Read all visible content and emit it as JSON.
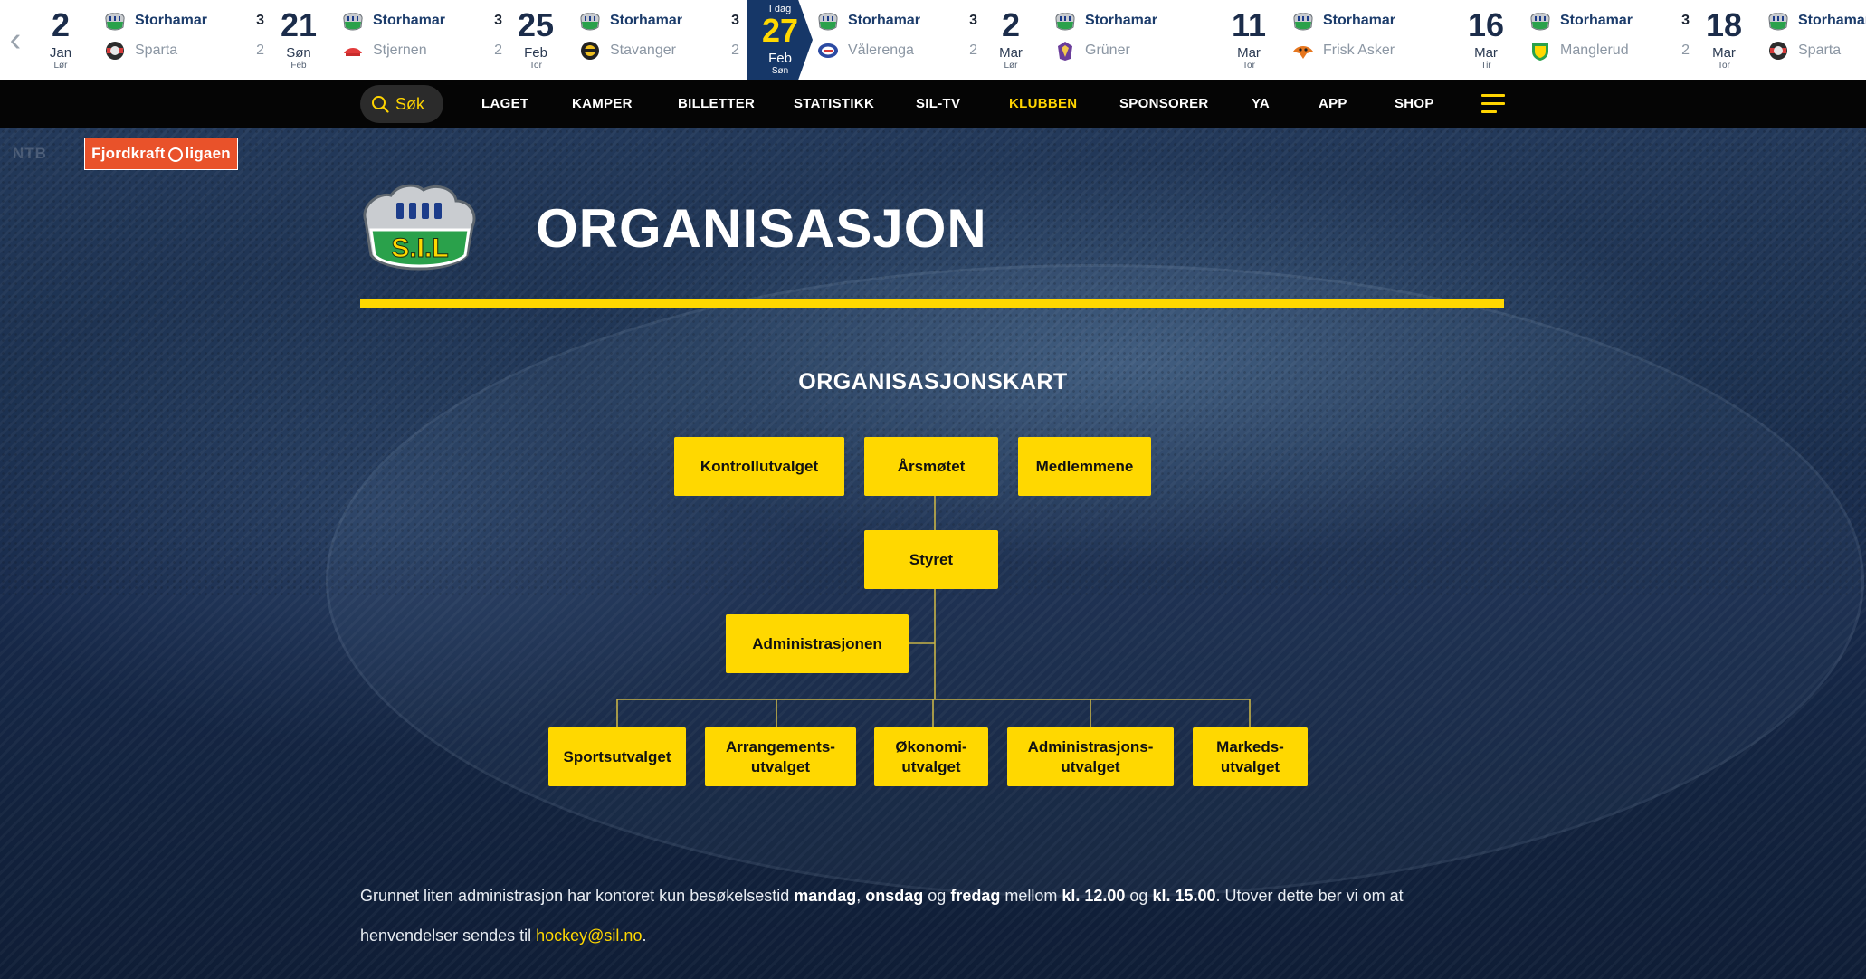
{
  "matches": [
    {
      "day": "2",
      "month": "Jan",
      "weekday": "Lør",
      "today_label": "",
      "home": "Storhamar",
      "home_score": "3",
      "away": "Sparta",
      "away_score": "2"
    },
    {
      "day": "21",
      "month": "Søn",
      "weekday": "Feb",
      "today_label": "",
      "home": "Storhamar",
      "home_score": "3",
      "away": "Stjernen",
      "away_score": "2"
    },
    {
      "day": "25",
      "month": "Feb",
      "weekday": "Tor",
      "today_label": "",
      "home": "Storhamar",
      "home_score": "3",
      "away": "Stavanger",
      "away_score": "2"
    },
    {
      "day": "27",
      "month": "Feb",
      "weekday": "Søn",
      "today_label": "I dag",
      "home": "Storhamar",
      "home_score": "3",
      "away": "Vålerenga",
      "away_score": "2"
    },
    {
      "day": "2",
      "month": "Mar",
      "weekday": "Lør",
      "today_label": "",
      "home": "Storhamar",
      "home_score": "",
      "away": "Grüner",
      "away_score": ""
    },
    {
      "day": "11",
      "month": "Mar",
      "weekday": "Tor",
      "today_label": "",
      "home": "Storhamar",
      "home_score": "",
      "away": "Frisk Asker",
      "away_score": ""
    },
    {
      "day": "16",
      "month": "Mar",
      "weekday": "Tir",
      "today_label": "",
      "home": "Storhamar",
      "home_score": "3",
      "away": "Manglerud",
      "away_score": "2"
    },
    {
      "day": "18",
      "month": "Mar",
      "weekday": "Tor",
      "today_label": "",
      "home": "Storhamar",
      "home_score": "",
      "away": "Sparta",
      "away_score": ""
    }
  ],
  "nav": {
    "search_label": "Søk",
    "items": [
      "LAGET",
      "KAMPER",
      "BILLETTER",
      "STATISTIKK",
      "SIL-TV",
      "KLUBBEN",
      "SPONSORER",
      "YA",
      "APP",
      "SHOP"
    ],
    "active": "KLUBBEN"
  },
  "hero": {
    "sponsor_part1": "Fjordkraft",
    "sponsor_part2": "ligaen",
    "watermark": "NTB",
    "logo_text": "S.I.L",
    "title": "ORGANISASJON"
  },
  "org_chart": {
    "title": "ORGANISASJONSKART",
    "top": [
      "Kontrollutvalget",
      "Årsmøtet",
      "Medlemmene"
    ],
    "board": "Styret",
    "admin": "Administrasjonen",
    "committees": [
      [
        "Sportsutvalget"
      ],
      [
        "Arrangements-",
        "utvalget"
      ],
      [
        "Økonomi-",
        "utvalget"
      ],
      [
        "Administrasjons-",
        "utvalget"
      ],
      [
        "Markeds-",
        "utvalget"
      ]
    ]
  },
  "info": {
    "t1": "Grunnet liten administrasjon har kontoret kun besøkelsestid ",
    "d1": "mandag",
    "t2": ", ",
    "d2": "onsdag",
    "t3": " og ",
    "d3": "fredag",
    "t4": " mellom ",
    "h1": "kl. 12.00",
    "t5": " og ",
    "h2": "kl. 15.00",
    "t6": ". Utover dette ber vi om at henvendelser sendes til ",
    "email": "hockey@sil.no",
    "t7": "."
  },
  "colors": {
    "accent": "#ffd800",
    "nav_bg": "#050505",
    "today_bg": "#163768"
  }
}
